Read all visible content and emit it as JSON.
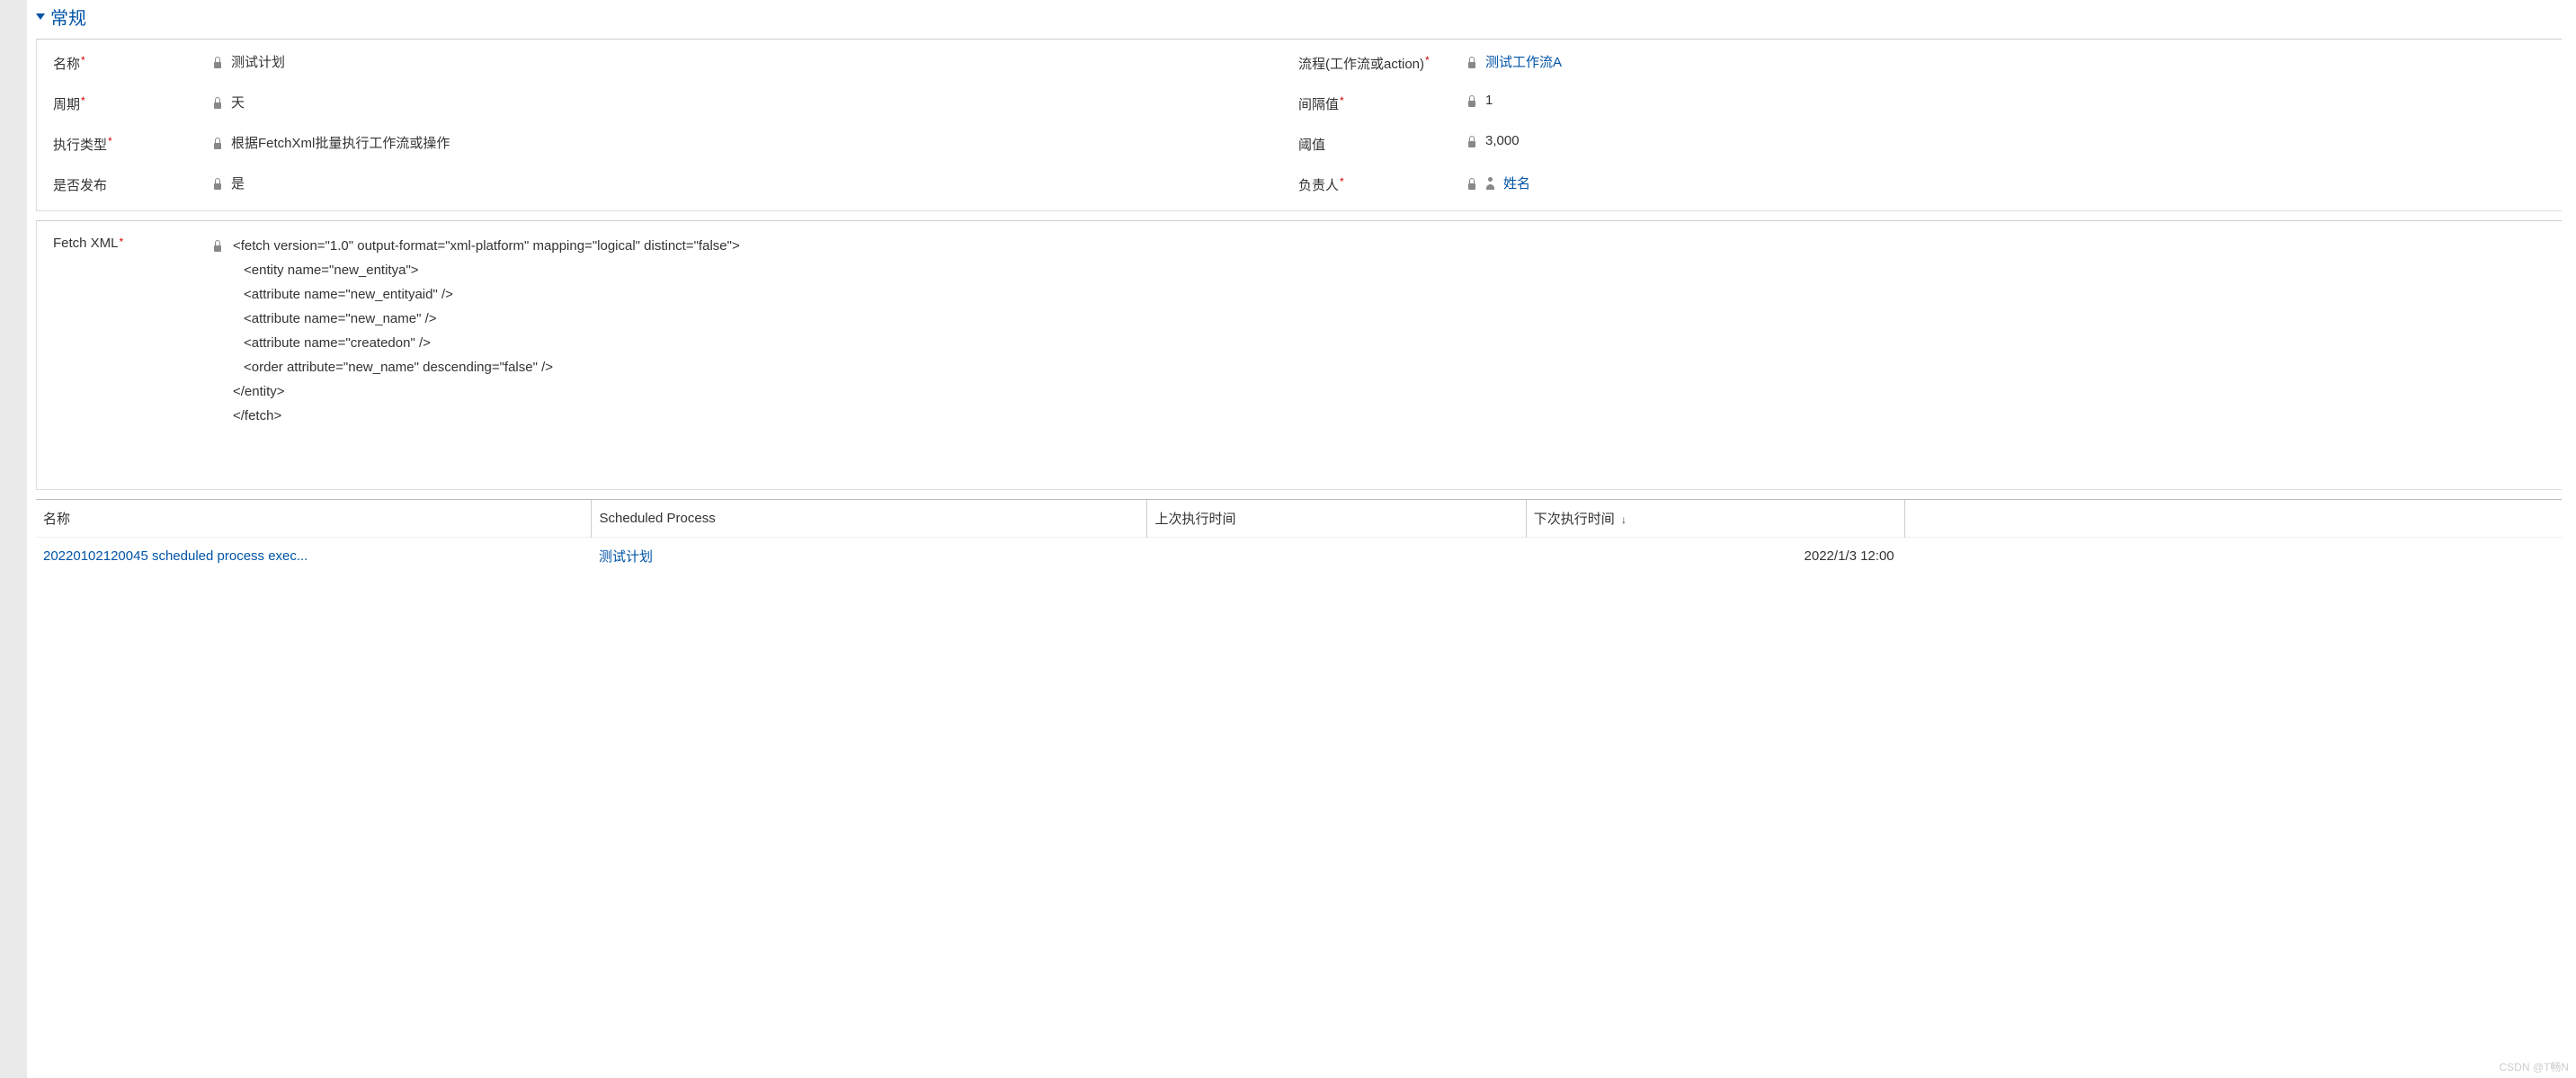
{
  "section": {
    "title": "常规"
  },
  "fields": {
    "name": {
      "label": "名称",
      "required": true,
      "value": "测试计划"
    },
    "process": {
      "label": "流程(工作流或action)",
      "required": true,
      "value": "测试工作流A"
    },
    "period": {
      "label": "周期",
      "required": true,
      "value": "天"
    },
    "interval": {
      "label": "间隔值",
      "required": true,
      "value": "1"
    },
    "exec_type": {
      "label": "执行类型",
      "required": true,
      "value": "根据FetchXml批量执行工作流或操作"
    },
    "threshold": {
      "label": "阈值",
      "required": false,
      "value": "3,000"
    },
    "published": {
      "label": "是否发布",
      "required": false,
      "value": "是"
    },
    "owner": {
      "label": "负责人",
      "required": true,
      "value": "姓名"
    },
    "fetchxml": {
      "label": "Fetch XML",
      "required": true
    }
  },
  "fetchxml_lines": [
    "<fetch version=\"1.0\" output-format=\"xml-platform\" mapping=\"logical\" distinct=\"false\">",
    "<entity name=\"new_entitya\">",
    "<attribute name=\"new_entityaid\" />",
    "<attribute name=\"new_name\" />",
    "<attribute name=\"createdon\" />",
    "<order attribute=\"new_name\" descending=\"false\" />",
    "</entity>",
    "</fetch>"
  ],
  "grid": {
    "columns": {
      "name": "名称",
      "scheduled_process": "Scheduled Process",
      "last_run": "上次执行时间",
      "next_run": "下次执行时间",
      "sort_desc": "↓"
    },
    "rows": [
      {
        "name": "20220102120045 scheduled process exec...",
        "scheduled_process": "测试计划",
        "last_run": "",
        "next_run": "2022/1/3 12:00"
      }
    ]
  },
  "watermark": "CSDN @T畅N"
}
